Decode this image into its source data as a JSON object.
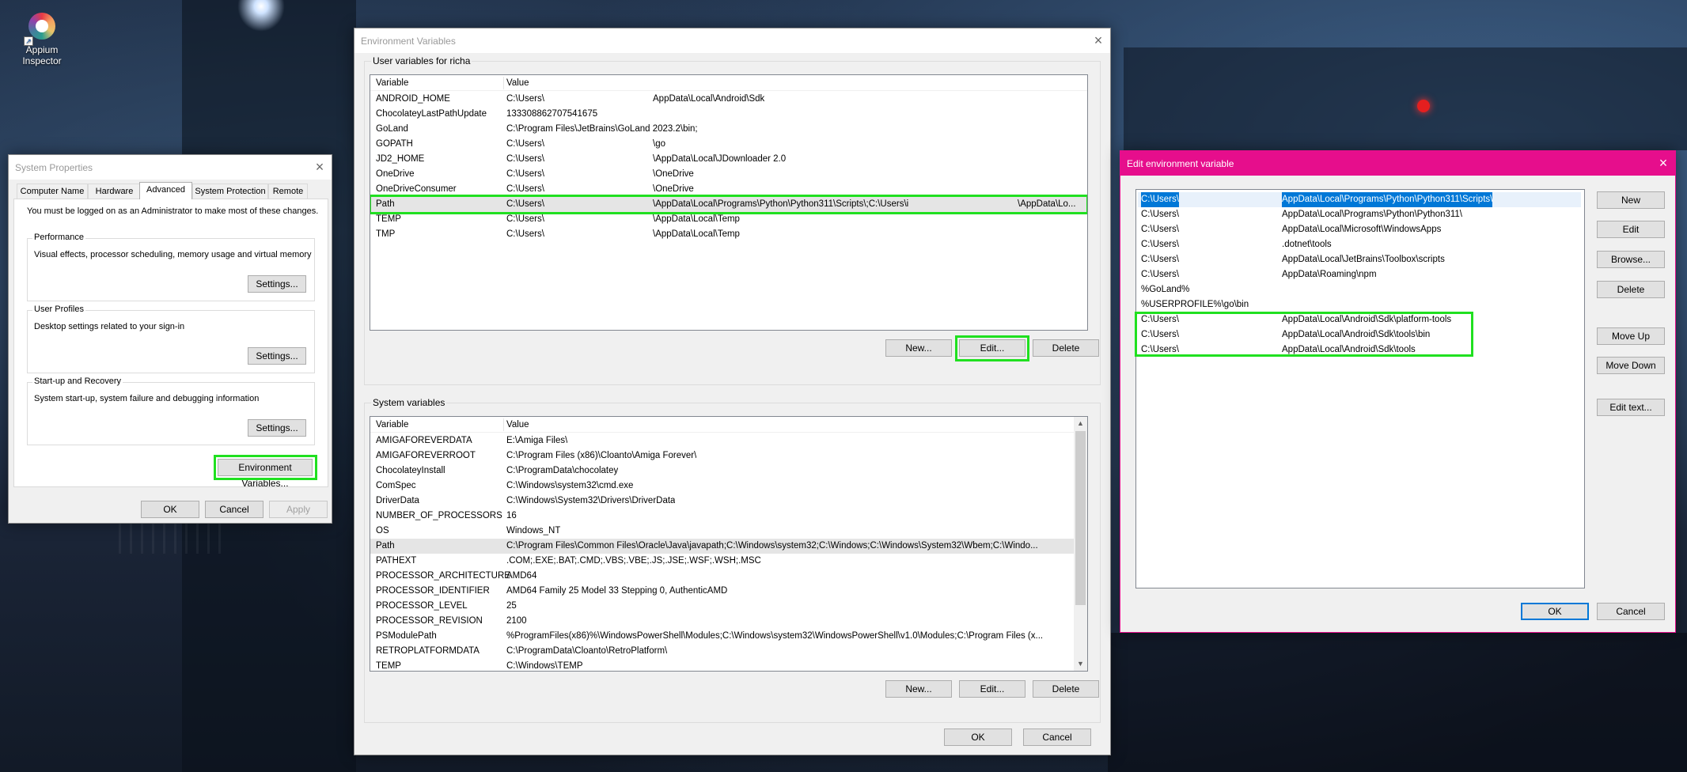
{
  "desktop": {
    "icon_label": "Appium\nInspector"
  },
  "sysprops": {
    "title": "System Properties",
    "tabs": [
      "Computer Name",
      "Hardware",
      "Advanced",
      "System Protection",
      "Remote"
    ],
    "note": "You must be logged on as an Administrator to make most of these changes.",
    "performance": {
      "label": "Performance",
      "desc": "Visual effects, processor scheduling, memory usage and virtual memory",
      "button": "Settings..."
    },
    "profiles": {
      "label": "User Profiles",
      "desc": "Desktop settings related to your sign-in",
      "button": "Settings..."
    },
    "startup": {
      "label": "Start-up and Recovery",
      "desc": "System start-up, system failure and debugging information",
      "button": "Settings..."
    },
    "env_button": "Environment Variables...",
    "ok": "OK",
    "cancel": "Cancel",
    "apply": "Apply"
  },
  "envvars": {
    "title": "Environment Variables",
    "user_section": "User variables for richa",
    "system_section": "System variables",
    "col_variable": "Variable",
    "col_value": "Value",
    "user_rows": [
      {
        "name": "ANDROID_HOME",
        "v1": "C:\\Users\\",
        "v2": "AppData\\Local\\Android\\Sdk"
      },
      {
        "name": "ChocolateyLastPathUpdate",
        "v1": "133308862707541675",
        "v2": ""
      },
      {
        "name": "GoLand",
        "v1": "C:\\Program Files\\JetBrains\\GoLand 2023.2\\bin;",
        "v2": ""
      },
      {
        "name": "GOPATH",
        "v1": "C:\\Users\\",
        "v2": "\\go"
      },
      {
        "name": "JD2_HOME",
        "v1": "C:\\Users\\",
        "v2": "\\AppData\\Local\\JDownloader 2.0"
      },
      {
        "name": "OneDrive",
        "v1": "C:\\Users\\",
        "v2": "\\OneDrive"
      },
      {
        "name": "OneDriveConsumer",
        "v1": "C:\\Users\\",
        "v2": "\\OneDrive"
      },
      {
        "name": "Path",
        "v1": "C:\\Users\\",
        "v2": "\\AppData\\Local\\Programs\\Python\\Python311\\Scripts\\;C:\\Users\\i",
        "v3": "\\AppData\\Lo..."
      },
      {
        "name": "TEMP",
        "v1": "C:\\Users\\",
        "v2": "\\AppData\\Local\\Temp"
      },
      {
        "name": "TMP",
        "v1": "C:\\Users\\",
        "v2": "\\AppData\\Local\\Temp"
      }
    ],
    "system_rows": [
      {
        "name": "AMIGAFOREVERDATA",
        "v1": "E:\\Amiga Files\\"
      },
      {
        "name": "AMIGAFOREVERROOT",
        "v1": "C:\\Program Files (x86)\\Cloanto\\Amiga Forever\\"
      },
      {
        "name": "ChocolateyInstall",
        "v1": "C:\\ProgramData\\chocolatey"
      },
      {
        "name": "ComSpec",
        "v1": "C:\\Windows\\system32\\cmd.exe"
      },
      {
        "name": "DriverData",
        "v1": "C:\\Windows\\System32\\Drivers\\DriverData"
      },
      {
        "name": "NUMBER_OF_PROCESSORS",
        "v1": "16"
      },
      {
        "name": "OS",
        "v1": "Windows_NT"
      },
      {
        "name": "Path",
        "v1": "C:\\Program Files\\Common Files\\Oracle\\Java\\javapath;C:\\Windows\\system32;C:\\Windows;C:\\Windows\\System32\\Wbem;C:\\Windo..."
      },
      {
        "name": "PATHEXT",
        "v1": ".COM;.EXE;.BAT;.CMD;.VBS;.VBE;.JS;.JSE;.WSF;.WSH;.MSC"
      },
      {
        "name": "PROCESSOR_ARCHITECTURE",
        "v1": "AMD64"
      },
      {
        "name": "PROCESSOR_IDENTIFIER",
        "v1": "AMD64 Family 25 Model 33 Stepping 0, AuthenticAMD"
      },
      {
        "name": "PROCESSOR_LEVEL",
        "v1": "25"
      },
      {
        "name": "PROCESSOR_REVISION",
        "v1": "2100"
      },
      {
        "name": "PSModulePath",
        "v1": "%ProgramFiles(x86)%\\WindowsPowerShell\\Modules;C:\\Windows\\system32\\WindowsPowerShell\\v1.0\\Modules;C:\\Program Files (x..."
      },
      {
        "name": "RETROPLATFORMDATA",
        "v1": "C:\\ProgramData\\Cloanto\\RetroPlatform\\"
      },
      {
        "name": "TEMP",
        "v1": "C:\\Windows\\TEMP"
      }
    ],
    "new": "New...",
    "edit": "Edit...",
    "delete": "Delete",
    "ok": "OK",
    "cancel": "Cancel"
  },
  "editenv": {
    "title": "Edit environment variable",
    "rows": [
      {
        "p1": "C:\\Users\\",
        "p2": "AppData\\Local\\Programs\\Python\\Python311\\Scripts\\"
      },
      {
        "p1": "C:\\Users\\",
        "p2": "AppData\\Local\\Programs\\Python\\Python311\\"
      },
      {
        "p1": "C:\\Users\\",
        "p2": "AppData\\Local\\Microsoft\\WindowsApps"
      },
      {
        "p1": "C:\\Users\\",
        "p2": ".dotnet\\tools"
      },
      {
        "p1": "C:\\Users\\",
        "p2": "AppData\\Local\\JetBrains\\Toolbox\\scripts"
      },
      {
        "p1": "C:\\Users\\",
        "p2": "AppData\\Roaming\\npm"
      },
      {
        "p1": "%GoLand%",
        "p2": ""
      },
      {
        "p1": "%USERPROFILE%\\go\\bin",
        "p2": ""
      },
      {
        "p1": "C:\\Users\\",
        "p2": "AppData\\Local\\Android\\Sdk\\platform-tools"
      },
      {
        "p1": "C:\\Users\\",
        "p2": "AppData\\Local\\Android\\Sdk\\tools\\bin"
      },
      {
        "p1": "C:\\Users\\",
        "p2": "AppData\\Local\\Android\\Sdk\\tools"
      }
    ],
    "buttons": [
      "New",
      "Edit",
      "Browse...",
      "Delete",
      "Move Up",
      "Move Down",
      "Edit text..."
    ],
    "ok": "OK",
    "cancel": "Cancel"
  }
}
